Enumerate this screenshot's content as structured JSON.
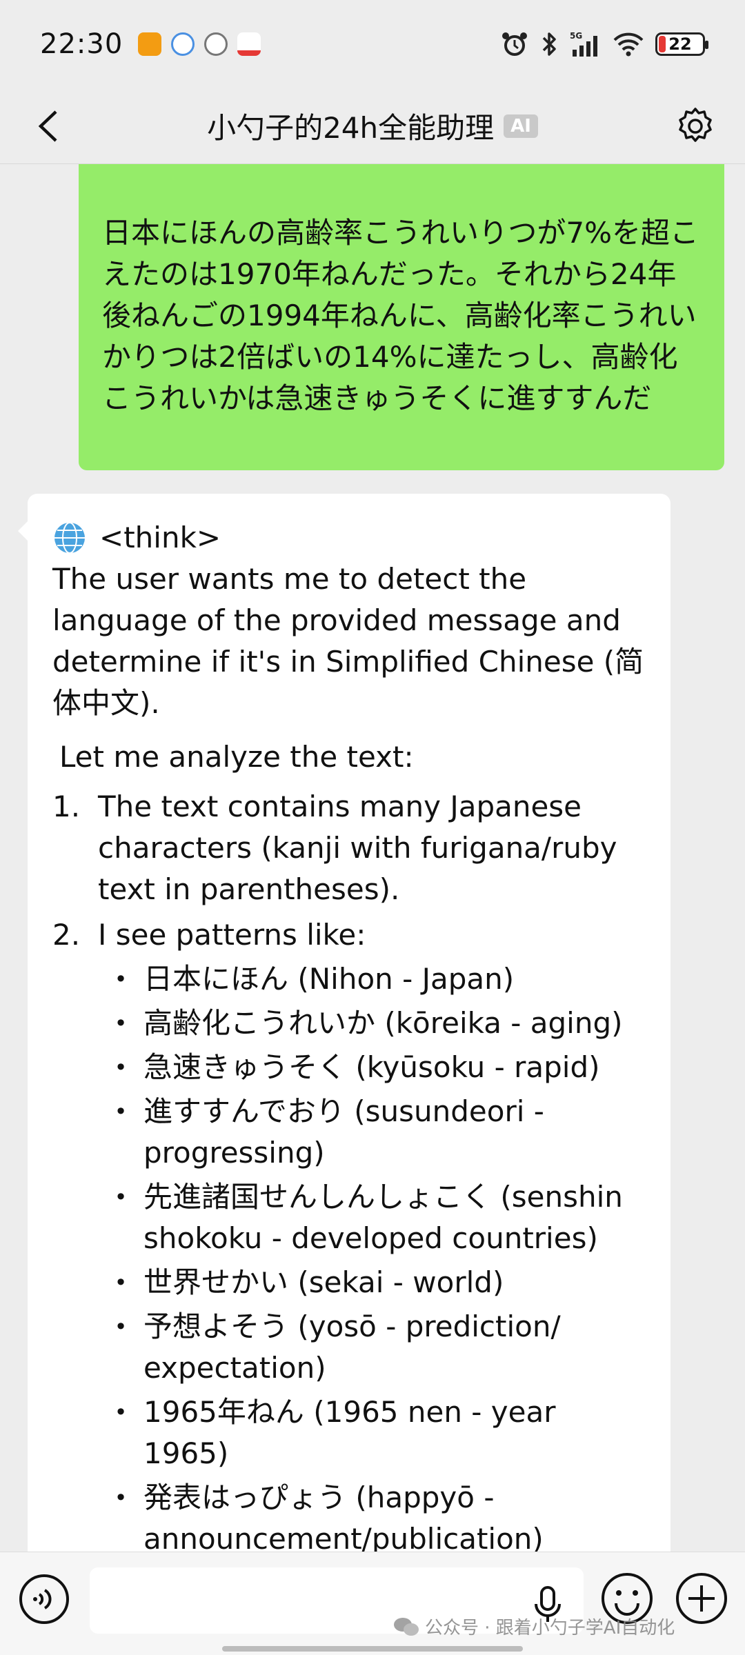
{
  "status_bar": {
    "time": "22:30",
    "battery": "22",
    "icons": [
      "alarm-icon",
      "bluetooth-icon",
      "signal-5g-icon",
      "wifi-icon",
      "battery-icon"
    ],
    "notif_colors": [
      "#f39c12",
      "#4a90e2",
      "#9e9e9e",
      "#e53935"
    ]
  },
  "header": {
    "title": "小勺子的24h全能助理",
    "badge": "AI"
  },
  "messages": {
    "user": {
      "text": "日本にほんの高齢率こうれいりつが7%を超こえたのは1970年ねんだった。それから24年後ねんごの1994年ねんに、高齢化率こうれいかりつは2倍ばいの14%に達たっし、高齢化こうれいかは急速きゅうそくに進すすんだ"
    },
    "ai": {
      "think": "<think>",
      "intro": "The user wants me to detect the language of the provided message and determine if it's in Simplified Chinese (简体中文).",
      "analyze": "Let me analyze the text:",
      "items": [
        {
          "num": "1.",
          "text": "The text contains many Japanese characters (kanji with furigana/ruby text in parentheses)."
        },
        {
          "num": "2.",
          "text": "I see patterns like:"
        }
      ],
      "bullets": [
        "日本にほん (Nihon - Japan)",
        "高齢化こうれいか (kōreika - aging)",
        "急速きゅうそく (kyūsoku - rapid)",
        "進すすんでおり (susundeori - progressing)",
        "先進諸国せんしんしょこく (senshin shokoku - developed countries)",
        "世界せかい (sekai - world)",
        "予想よそう (yosō - prediction/ expectation)",
        "1965年ねん (1965 nen - year 1965)",
        "発表はっぴょう (happyō - announcement/publication)"
      ]
    }
  },
  "input_bar": {
    "placeholder": "",
    "watermark": "公众号 · 跟着小勺子学AI自动化"
  },
  "colors": {
    "user_bubble": "#95ec69",
    "background": "#ededed"
  }
}
